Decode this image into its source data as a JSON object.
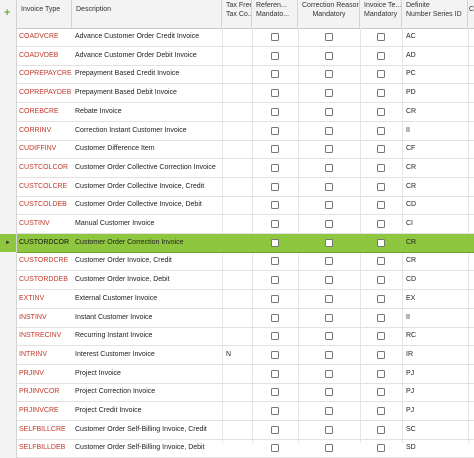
{
  "columns": {
    "type": "Invoice Type",
    "description": "Description",
    "tax_free": "Tax Free\nTax Co...",
    "ref_mandatory": "Referen...\nMandato...",
    "correction_reason": "Correction Reason\nMandatory",
    "template_mandatory": "Invoice Te...\nMandatory",
    "definite_series": "Definite\nNumber Series ID",
    "extra": "C"
  },
  "header_add_icon": "plus-icon",
  "selected_marker": "►",
  "rows": [
    {
      "type": "COADVCRE",
      "description": "Advance Customer Order Credit Invoice",
      "tax": "",
      "series": "AC",
      "selected": false
    },
    {
      "type": "COADVDEB",
      "description": "Advance Customer Order Debit Invoice",
      "tax": "",
      "series": "AD",
      "selected": false
    },
    {
      "type": "COPREPAYCRE",
      "description": "Prepayment Based Credit Invoice",
      "tax": "",
      "series": "PC",
      "selected": false
    },
    {
      "type": "COPREPAYDEB",
      "description": "Prepayment Based Debit Invoice",
      "tax": "",
      "series": "PD",
      "selected": false
    },
    {
      "type": "COREBCRE",
      "description": "Rebate Invoice",
      "tax": "",
      "series": "CR",
      "selected": false
    },
    {
      "type": "CORRINV",
      "description": "Correction Instant Customer Invoice",
      "tax": "",
      "series": "II",
      "selected": false
    },
    {
      "type": "CUDIFFINV",
      "description": "Customer Difference Item",
      "tax": "",
      "series": "CF",
      "selected": false
    },
    {
      "type": "CUSTCOLCOR",
      "description": "Customer Order Collective Correction Invoice",
      "tax": "",
      "series": "CR",
      "selected": false
    },
    {
      "type": "CUSTCOLCRE",
      "description": "Customer Order Collective Invoice, Credit",
      "tax": "",
      "series": "CR",
      "selected": false
    },
    {
      "type": "CUSTCOLDEB",
      "description": "Customer Order Collective Invoice, Debit",
      "tax": "",
      "series": "CD",
      "selected": false
    },
    {
      "type": "CUSTINV",
      "description": "Manual Customer Invoice",
      "tax": "",
      "series": "CI",
      "selected": false
    },
    {
      "type": "CUSTORDCOR",
      "description": "Customer Order Correction Invoice",
      "tax": "",
      "series": "CR",
      "selected": true
    },
    {
      "type": "CUSTORDCRE",
      "description": "Customer Order Invoice, Credit",
      "tax": "",
      "series": "CR",
      "selected": false
    },
    {
      "type": "CUSTORDDEB",
      "description": "Customer Order Invoice, Debit",
      "tax": "",
      "series": "CD",
      "selected": false
    },
    {
      "type": "EXTINV",
      "description": "External Customer Invoice",
      "tax": "",
      "series": "EX",
      "selected": false
    },
    {
      "type": "INSTINV",
      "description": "Instant Customer Invoice",
      "tax": "",
      "series": "II",
      "selected": false
    },
    {
      "type": "INSTRECINV",
      "description": "Recurring Instant Invoice",
      "tax": "",
      "series": "RC",
      "selected": false
    },
    {
      "type": "INTRINV",
      "description": "Interest Customer Invoice",
      "tax": "N",
      "series": "IR",
      "selected": false
    },
    {
      "type": "PRJINV",
      "description": "Project Invoice",
      "tax": "",
      "series": "PJ",
      "selected": false
    },
    {
      "type": "PRJINVCOR",
      "description": "Project Correction Invoice",
      "tax": "",
      "series": "PJ",
      "selected": false
    },
    {
      "type": "PRJINVCRE",
      "description": "Project Credit Invoice",
      "tax": "",
      "series": "PJ",
      "selected": false
    },
    {
      "type": "SELFBILLCRE",
      "description": "Customer Order Self-Billing Invoice, Credit",
      "tax": "",
      "series": "SC",
      "selected": false
    },
    {
      "type": "SELFBILLDEB",
      "description": "Customer Order Self-Billing Invoice, Debit",
      "tax": "",
      "series": "SD",
      "selected": false
    }
  ]
}
